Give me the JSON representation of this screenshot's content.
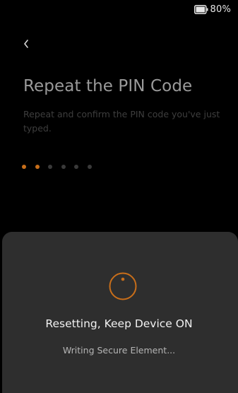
{
  "status_bar": {
    "battery_text": "80%",
    "battery_level": 0.8,
    "battery_icon": "battery-icon"
  },
  "header": {
    "back_icon": "chevron-left-icon"
  },
  "main": {
    "title": "Repeat the PIN Code",
    "subtitle": "Repeat and confirm the PIN code you've just typed.",
    "pin": {
      "length": 6,
      "entered": 2
    }
  },
  "sheet": {
    "spinner_icon": "spinner-icon",
    "title": "Resetting, Keep Device ON",
    "status": "Writing Secure Element..."
  },
  "colors": {
    "accent": "#c86e1a",
    "background": "#000000",
    "sheet_background": "#2e2e2e"
  }
}
